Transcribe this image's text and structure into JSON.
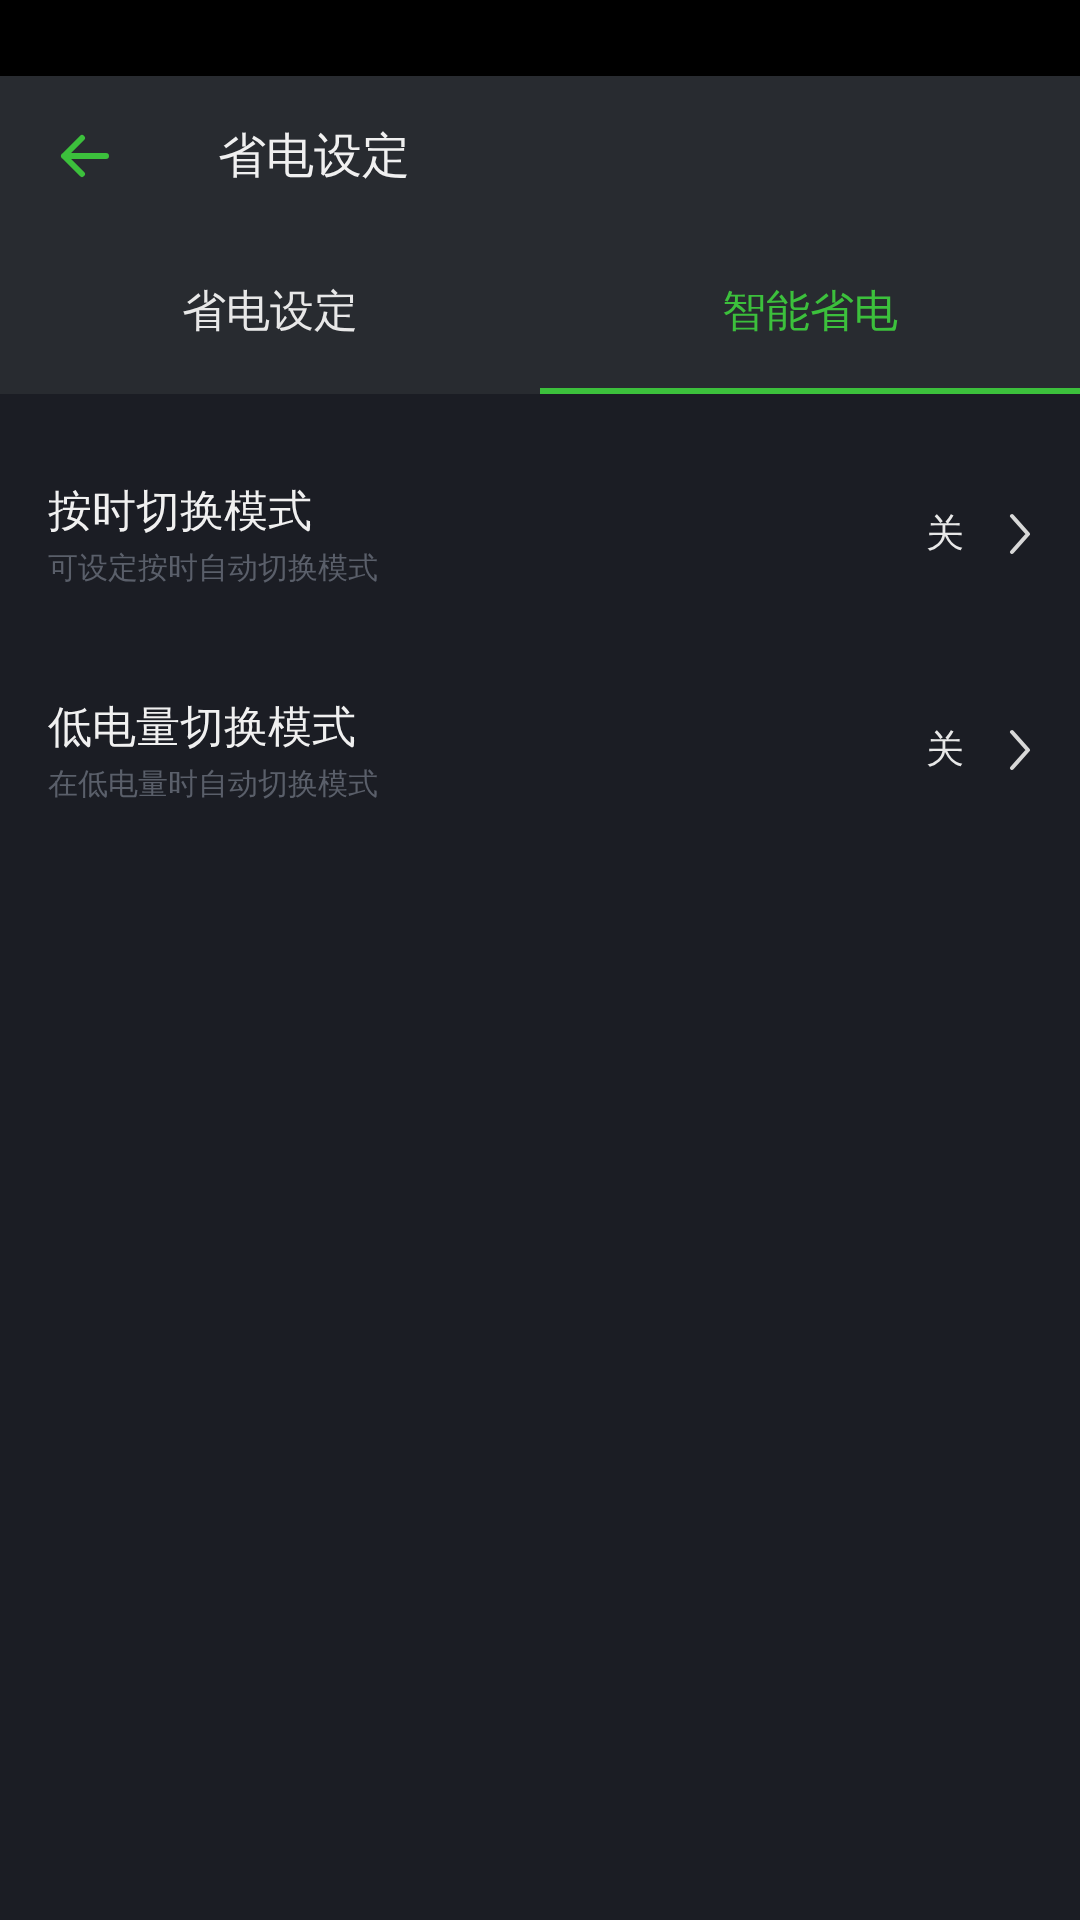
{
  "header": {
    "title": "省电设定"
  },
  "tabs": [
    {
      "label": "省电设定",
      "selected": false
    },
    {
      "label": "智能省电",
      "selected": true
    }
  ],
  "settings": [
    {
      "title": "按时切换模式",
      "subtitle": "可设定按时自动切换模式",
      "value": "关"
    },
    {
      "title": "低电量切换模式",
      "subtitle": "在低电量时自动切换模式",
      "value": "关"
    }
  ]
}
